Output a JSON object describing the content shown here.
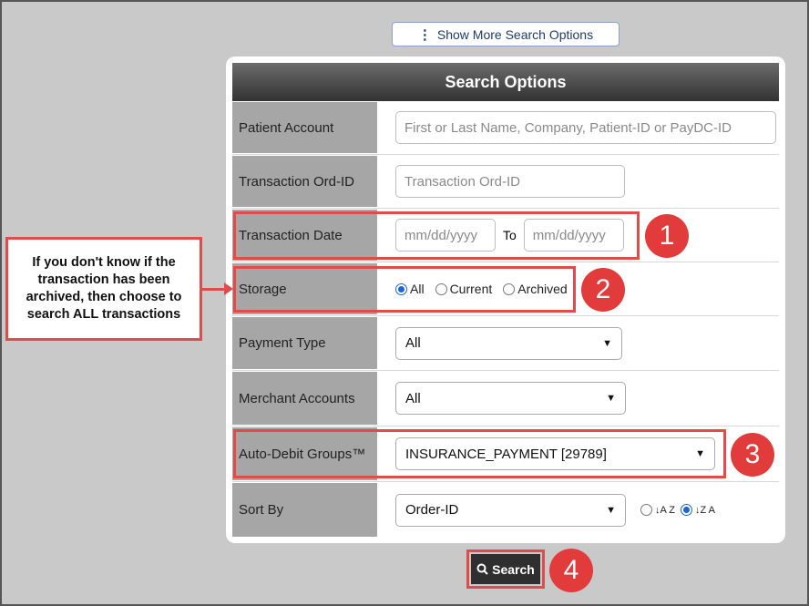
{
  "show_more": {
    "label": "Show More Search Options"
  },
  "panel": {
    "title": "Search Options"
  },
  "fields": {
    "patient_account": {
      "label": "Patient Account",
      "placeholder": "First or Last Name, Company, Patient-ID or PayDC-ID"
    },
    "transaction_ord_id": {
      "label": "Transaction Ord-ID",
      "placeholder": "Transaction Ord-ID"
    },
    "transaction_date": {
      "label": "Transaction Date",
      "from_placeholder": "mm/dd/yyyy",
      "to_label": "To",
      "to_placeholder": "mm/dd/yyyy"
    },
    "storage": {
      "label": "Storage",
      "options": [
        "All",
        "Current",
        "Archived"
      ],
      "selected": "All"
    },
    "payment_type": {
      "label": "Payment Type",
      "value": "All"
    },
    "merchant_accounts": {
      "label": "Merchant Accounts",
      "value": "All"
    },
    "auto_debit_groups": {
      "label": "Auto-Debit Groups™",
      "value": "INSURANCE_PAYMENT [29789]"
    },
    "sort_by": {
      "label": "Sort By",
      "value": "Order-ID",
      "asc_label": "↓A Z",
      "desc_label": "↓Z A",
      "selected_order": "desc"
    }
  },
  "callout": {
    "text": "If you don't know if the transaction has been archived, then choose to search ALL transactions"
  },
  "markers": [
    "1",
    "2",
    "3",
    "4"
  ],
  "search_button": {
    "label": "Search"
  },
  "colors": {
    "accent_red": "#e23b3b",
    "header_dark": "#323232",
    "label_bg": "#a6a6a6",
    "radio_blue": "#1a66d6"
  }
}
